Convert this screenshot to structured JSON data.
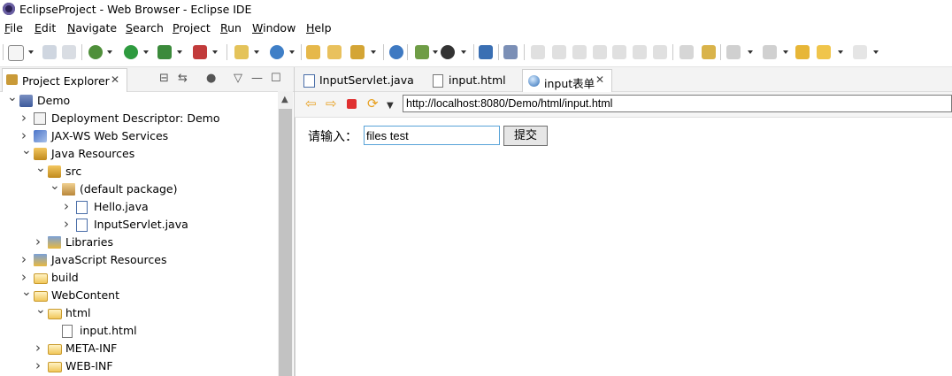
{
  "window": {
    "title": "EclipseProject - Web Browser - Eclipse IDE"
  },
  "menu": [
    "File",
    "Edit",
    "Navigate",
    "Search",
    "Project",
    "Run",
    "Window",
    "Help"
  ],
  "project_explorer": {
    "tab_label": "Project Explorer",
    "close_glyph": "✕",
    "tree": [
      {
        "label": "Demo",
        "icon": "project-icon",
        "level": 0,
        "expanded": true
      },
      {
        "label": "Deployment Descriptor: Demo",
        "icon": "deployment-descriptor-icon",
        "level": 1,
        "expanded": false
      },
      {
        "label": "JAX-WS Web Services",
        "icon": "web-services-icon",
        "level": 1,
        "expanded": false
      },
      {
        "label": "Java Resources",
        "icon": "java-resources-icon",
        "level": 1,
        "expanded": true
      },
      {
        "label": "src",
        "icon": "source-folder-icon",
        "level": 2,
        "expanded": true
      },
      {
        "label": "(default package)",
        "icon": "package-icon",
        "level": 3,
        "expanded": true
      },
      {
        "label": "Hello.java",
        "icon": "java-file-icon",
        "level": 4,
        "expanded": false
      },
      {
        "label": "InputServlet.java",
        "icon": "java-file-icon",
        "level": 4,
        "expanded": false
      },
      {
        "label": "Libraries",
        "icon": "libraries-icon",
        "level": 2,
        "expanded": false
      },
      {
        "label": "JavaScript Resources",
        "icon": "javascript-resources-icon",
        "level": 1,
        "expanded": false
      },
      {
        "label": "build",
        "icon": "folder-icon",
        "level": 1,
        "expanded": false
      },
      {
        "label": "WebContent",
        "icon": "folder-icon",
        "level": 1,
        "expanded": true
      },
      {
        "label": "html",
        "icon": "folder-icon",
        "level": 2,
        "expanded": true
      },
      {
        "label": "input.html",
        "icon": "html-file-icon",
        "level": 3,
        "leaf": true
      },
      {
        "label": "META-INF",
        "icon": "folder-icon",
        "level": 2,
        "expanded": false
      },
      {
        "label": "WEB-INF",
        "icon": "folder-icon",
        "level": 2,
        "expanded": false
      }
    ]
  },
  "editor_tabs": [
    {
      "label": "InputServlet.java",
      "icon": "java-file-icon",
      "active": false
    },
    {
      "label": "input.html",
      "icon": "html-file-icon",
      "active": false
    },
    {
      "label": "input表单",
      "icon": "globe-icon",
      "active": true,
      "close_glyph": "✕"
    }
  ],
  "browser": {
    "url": "http://localhost:8080/Demo/html/input.html",
    "page": {
      "prompt_label": "请输入：",
      "input_value": "files test",
      "submit_label": "提交"
    }
  },
  "colors": {
    "focus_border": "#59a3d8",
    "stop_red": "#e03030",
    "nav_yellow": "#e8a020"
  }
}
